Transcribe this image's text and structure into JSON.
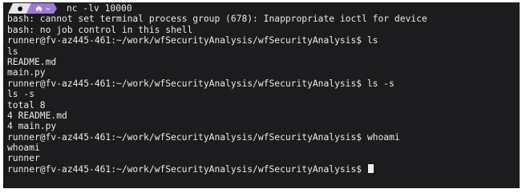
{
  "prompt_segment": {
    "colors": {
      "apple_bg": "#e6e6e6",
      "dir_bg": "#9b7ad9"
    },
    "icons": [
      "apple-icon",
      "home-icon"
    ]
  },
  "first_command": "nc -lv 10000",
  "lines": [
    "bash: cannot set terminal process group (678): Inappropriate ioctl for device",
    "bash: no job control in this shell",
    "runner@fv-az445-461:~/work/wfSecurityAnalysis/wfSecurityAnalysis$ ls",
    "ls",
    "README.md",
    "main.py",
    "runner@fv-az445-461:~/work/wfSecurityAnalysis/wfSecurityAnalysis$ ls -s",
    "ls -s",
    "total 8",
    "4 README.md",
    "4 main.py",
    "runner@fv-az445-461:~/work/wfSecurityAnalysis/wfSecurityAnalysis$ whoami",
    "whoami",
    "runner"
  ],
  "last_prompt": "runner@fv-az445-461:~/work/wfSecurityAnalysis/wfSecurityAnalysis$ ",
  "colors": {
    "terminal_bg": "#1c1c1e",
    "text": "#eaeaea",
    "cursor": "#ededed"
  }
}
